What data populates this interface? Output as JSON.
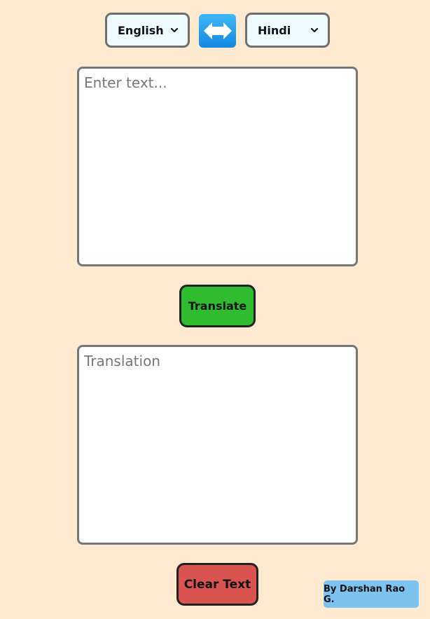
{
  "language_bar": {
    "from_language": "English",
    "to_language": "Hindi",
    "swap_icon": "left-right-arrow-icon",
    "accent_color": "#1e97ea"
  },
  "input": {
    "placeholder": "Enter text..."
  },
  "output": {
    "placeholder": "Translation"
  },
  "actions": {
    "translate_label": "Translate",
    "translate_color": "#2fbd2f",
    "clear_label": "Clear Text",
    "clear_color": "#d9534f"
  },
  "footer": {
    "credit": "By Darshan Rao G.",
    "credit_color": "#7cc3ef"
  },
  "page": {
    "background": "#feead0"
  }
}
